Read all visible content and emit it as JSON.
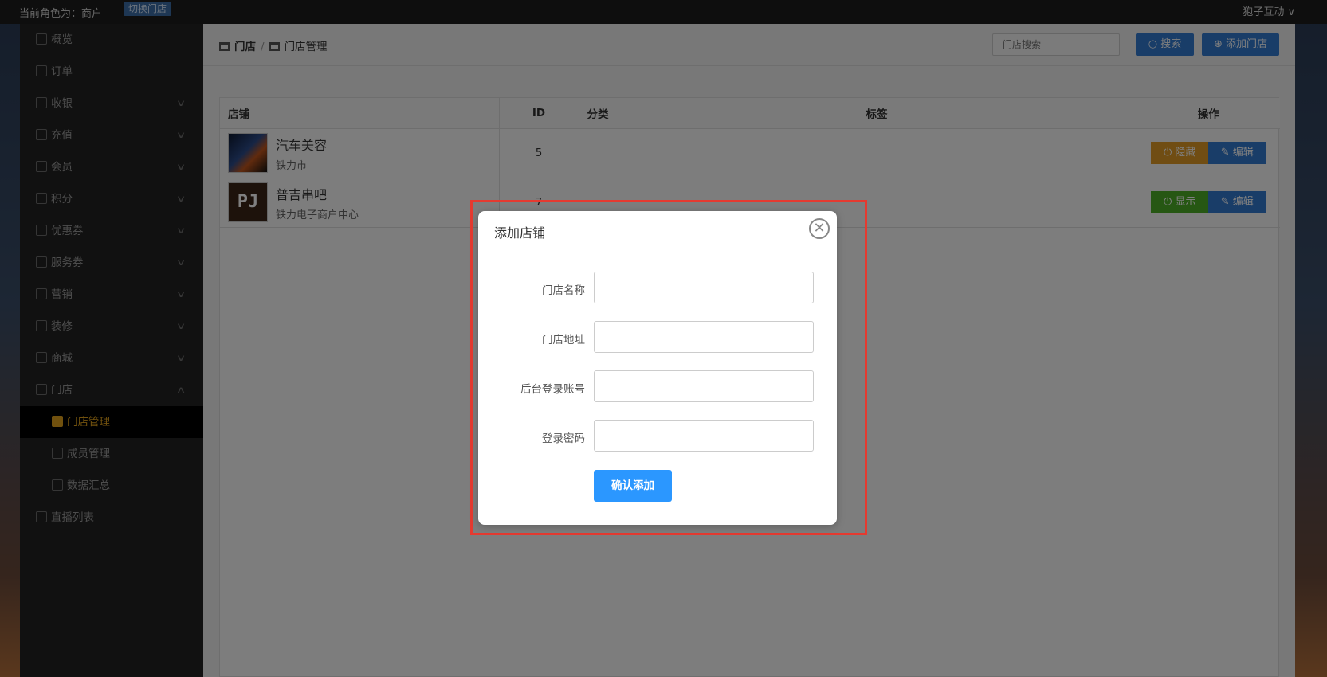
{
  "topbar": {
    "role_text": "当前角色为：商户",
    "switch_label": "切换门店",
    "user_name": "狍子互动 ∨"
  },
  "sidebar": {
    "items": [
      {
        "label": "概览",
        "icon": "home-icon",
        "chevron": ""
      },
      {
        "label": "订单",
        "icon": "order-icon",
        "chevron": ""
      },
      {
        "label": "收银",
        "icon": "cashier-icon",
        "chevron": "∨"
      },
      {
        "label": "充值",
        "icon": "recharge-icon",
        "chevron": "∨"
      },
      {
        "label": "会员",
        "icon": "member-icon",
        "chevron": "∨"
      },
      {
        "label": "积分",
        "icon": "points-icon",
        "chevron": "∨"
      },
      {
        "label": "优惠券",
        "icon": "coupon-icon",
        "chevron": "∨"
      },
      {
        "label": "服务券",
        "icon": "service-coupon-icon",
        "chevron": "∨"
      },
      {
        "label": "营销",
        "icon": "marketing-icon",
        "chevron": "∨"
      },
      {
        "label": "装修",
        "icon": "decorate-icon",
        "chevron": "∨"
      },
      {
        "label": "商城",
        "icon": "mall-icon",
        "chevron": "∨"
      },
      {
        "label": "门店",
        "icon": "store-icon",
        "chevron": "∧"
      },
      {
        "label": "门店管理",
        "icon": "store-manage-icon",
        "chevron": "",
        "sub": true,
        "active": true
      },
      {
        "label": "成员管理",
        "icon": "members-icon",
        "chevron": "",
        "sub": true
      },
      {
        "label": "数据汇总",
        "icon": "data-icon",
        "chevron": "",
        "sub": true
      },
      {
        "label": "直播列表",
        "icon": "live-icon",
        "chevron": ""
      }
    ]
  },
  "header": {
    "crumb_root": "门店",
    "crumb_sep": "/",
    "crumb_current": "门店管理",
    "search_placeholder": "门店搜索",
    "search_button": "搜索",
    "add_button": "添加门店"
  },
  "table": {
    "columns": [
      "店铺",
      "ID",
      "分类",
      "标签",
      "操作"
    ],
    "rows": [
      {
        "name": "汽车美容",
        "sub": "铁力市",
        "id": "5",
        "category": "",
        "tag": "",
        "toggle": "隐藏",
        "edit": "编辑"
      },
      {
        "name": "普吉串吧",
        "sub": "铁力电子商户中心",
        "id": "7",
        "category": "",
        "tag": "",
        "toggle": "显示",
        "edit": "编辑"
      }
    ]
  },
  "modal": {
    "title": "添加店铺",
    "close_icon": "close-circle-icon",
    "fields": [
      {
        "label": "门店名称",
        "value": ""
      },
      {
        "label": "门店地址",
        "value": ""
      },
      {
        "label": "后台登录账号",
        "value": ""
      },
      {
        "label": "登录密码",
        "value": ""
      }
    ],
    "submit": "确认添加"
  },
  "colors": {
    "accent": "#337ad0",
    "active_nav": "#e3a31c",
    "highlight": "#e53a30",
    "submit": "#2b97ff"
  }
}
